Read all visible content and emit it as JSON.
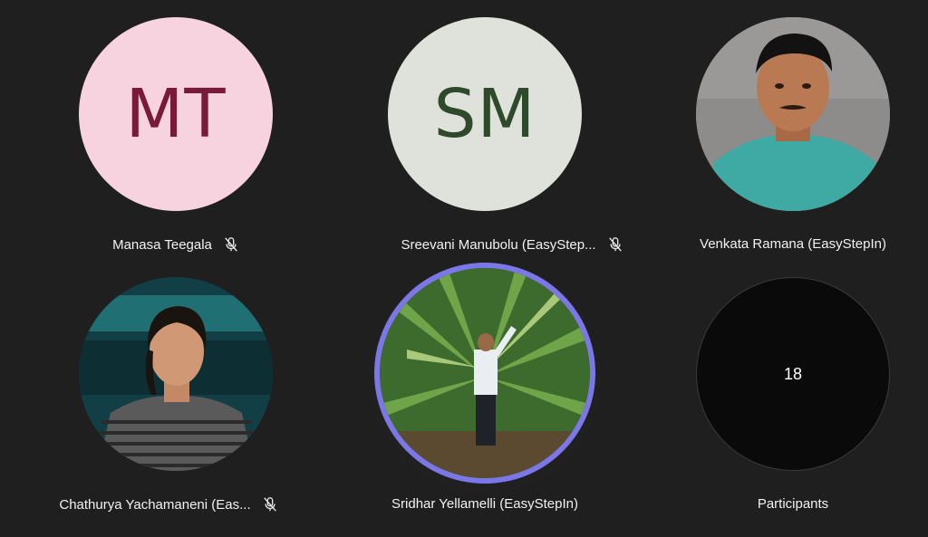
{
  "participants": [
    {
      "name": "Manasa Teegala",
      "initials": "MT",
      "avatar_bg": "#f6d3de",
      "initials_color": "#7a1a3b",
      "muted": true
    },
    {
      "name": "Sreevani Manubolu (EasyStep...",
      "initials": "SM",
      "avatar_bg": "#dfe2db",
      "initials_color": "#2f4a2b",
      "muted": true
    },
    {
      "name": "Venkata Ramana (EasyStepIn)",
      "photo": "man-in-teal-shirt",
      "muted": false
    },
    {
      "name": "Chathurya Yachamaneni (Eas...",
      "photo": "woman-in-striped-top",
      "muted": true
    },
    {
      "name": "Sridhar Yellamelli (EasyStepIn)",
      "photo": "man-among-palm-leaves",
      "muted": false,
      "speaking": true,
      "speaking_ring_color": "#7b77e6"
    }
  ],
  "overflow": {
    "count": "18",
    "label": "Participants"
  },
  "icons": {
    "muted": "mic-off-icon"
  }
}
